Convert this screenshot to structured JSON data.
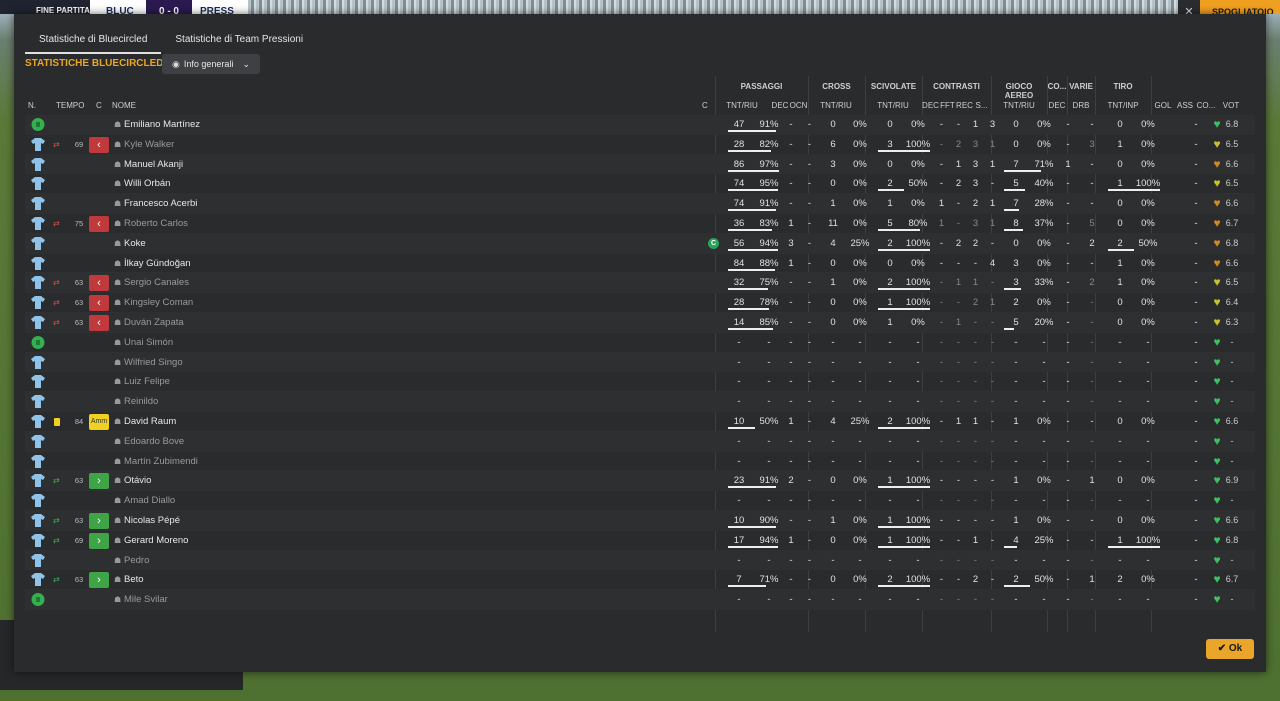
{
  "topbar": {
    "fine": "FINE PARTITA",
    "team_home": "BLUC",
    "score": "0 - 0",
    "team_away": "PRESS",
    "close": "✕",
    "spogliatoio": "SPOGLIATOIO"
  },
  "tabs": [
    {
      "label": "Statistiche di Bluecircled"
    },
    {
      "label": "Statistiche di Team Pressioni"
    }
  ],
  "panel_title": "STATISTICHE BLUECIRCLED",
  "dropdown": {
    "label": "Info generali"
  },
  "groups": {
    "passaggi": "PASSAGGI",
    "cross": "CROSS",
    "scivolate": "SCIVOLATE",
    "contrasti": "CONTRASTI",
    "gioco_aereo": "GIOCO AEREO",
    "co": "CO...",
    "varie": "VARIE",
    "tiro": "TIRO"
  },
  "columns": {
    "n": "N.",
    "tempo": "TEMPO",
    "c": "C",
    "nome": "NOME",
    "cap": "C",
    "pass_tnt": "TNT/RIU",
    "pass_dec": "DEC",
    "pass_ocn": "OCN",
    "cross_tnt": "TNT/RIU",
    "sciv_tnt": "TNT/RIU",
    "con_dec": "DEC",
    "con_fft": "FFT",
    "con_rec": "REC",
    "con_s": "S...",
    "aer_tnt": "TNT/RIU",
    "co_dec": "DEC",
    "drb": "DRB",
    "tiro": "TNT/INP",
    "gol": "GOL",
    "ass": "ASS",
    "cond": "CO...",
    "vot": "VOT"
  },
  "ok_label": "Ok",
  "colors": {
    "accent": "#e9a62a",
    "heart_green": "#3cc060",
    "heart_yellow": "#c8c030",
    "heart_orange": "#d08a20",
    "sub_out": "#c0393b",
    "sub_in": "#3fa446"
  },
  "players": [
    {
      "name": "Emiliano Martínez",
      "kit": "gk",
      "sub": "",
      "minute": "",
      "event": "",
      "pass": [
        "47",
        "91%"
      ],
      "pdec": "-",
      "pocn": "-",
      "cross": [
        "0",
        "0%"
      ],
      "sciv": [
        "0",
        "0%"
      ],
      "con": [
        "-",
        "-",
        "1",
        "3"
      ],
      "aer": [
        "0",
        "0%"
      ],
      "cdec": "-",
      "drb": "-",
      "tiro": [
        "0",
        "0%"
      ],
      "gol": "",
      "ass": "-",
      "cond": "green",
      "vot": "6.8",
      "dim": false,
      "capt": false
    },
    {
      "name": "Kyle Walker",
      "kit": "out",
      "sub": "out",
      "minute": "69",
      "event": "out",
      "pass": [
        "28",
        "82%"
      ],
      "pdec": "-",
      "pocn": "-",
      "cross": [
        "6",
        "0%"
      ],
      "sciv": [
        "3",
        "100%"
      ],
      "con": [
        "-",
        "2",
        "3",
        "1"
      ],
      "aer": [
        "0",
        "0%"
      ],
      "cdec": "-",
      "drb": "3",
      "tiro": [
        "1",
        "0%"
      ],
      "gol": "",
      "ass": "-",
      "cond": "yellow",
      "vot": "6.5",
      "dim": true,
      "capt": false
    },
    {
      "name": "Manuel Akanji",
      "kit": "out",
      "sub": "",
      "minute": "",
      "event": "",
      "pass": [
        "86",
        "97%"
      ],
      "pdec": "-",
      "pocn": "-",
      "cross": [
        "3",
        "0%"
      ],
      "sciv": [
        "0",
        "0%"
      ],
      "con": [
        "-",
        "1",
        "3",
        "1"
      ],
      "aer": [
        "7",
        "71%"
      ],
      "cdec": "1",
      "drb": "-",
      "tiro": [
        "0",
        "0%"
      ],
      "gol": "",
      "ass": "-",
      "cond": "orange",
      "vot": "6.6",
      "dim": false,
      "capt": false
    },
    {
      "name": "Willi Orbán",
      "kit": "out",
      "sub": "",
      "minute": "",
      "event": "",
      "pass": [
        "74",
        "95%"
      ],
      "pdec": "-",
      "pocn": "-",
      "cross": [
        "0",
        "0%"
      ],
      "sciv": [
        "2",
        "50%"
      ],
      "con": [
        "-",
        "2",
        "3",
        "-"
      ],
      "aer": [
        "5",
        "40%"
      ],
      "cdec": "-",
      "drb": "-",
      "tiro": [
        "1",
        "100%"
      ],
      "gol": "",
      "ass": "-",
      "cond": "yellow",
      "vot": "6.5",
      "dim": false,
      "capt": false
    },
    {
      "name": "Francesco Acerbi",
      "kit": "out",
      "sub": "",
      "minute": "",
      "event": "",
      "pass": [
        "74",
        "91%"
      ],
      "pdec": "-",
      "pocn": "-",
      "cross": [
        "1",
        "0%"
      ],
      "sciv": [
        "1",
        "0%"
      ],
      "con": [
        "1",
        "-",
        "2",
        "1"
      ],
      "aer": [
        "7",
        "28%"
      ],
      "cdec": "-",
      "drb": "-",
      "tiro": [
        "0",
        "0%"
      ],
      "gol": "",
      "ass": "-",
      "cond": "orange",
      "vot": "6.6",
      "dim": false,
      "capt": false
    },
    {
      "name": "Roberto Carlos",
      "kit": "out",
      "sub": "out",
      "minute": "75",
      "event": "out",
      "pass": [
        "36",
        "83%"
      ],
      "pdec": "1",
      "pocn": "-",
      "cross": [
        "11",
        "0%"
      ],
      "sciv": [
        "5",
        "80%"
      ],
      "con": [
        "1",
        "-",
        "3",
        "1"
      ],
      "aer": [
        "8",
        "37%"
      ],
      "cdec": "-",
      "drb": "5",
      "tiro": [
        "0",
        "0%"
      ],
      "gol": "",
      "ass": "-",
      "cond": "orange",
      "vot": "6.7",
      "dim": true,
      "capt": false
    },
    {
      "name": "Koke",
      "kit": "out",
      "sub": "",
      "minute": "",
      "event": "",
      "pass": [
        "56",
        "94%"
      ],
      "pdec": "3",
      "pocn": "-",
      "cross": [
        "4",
        "25%"
      ],
      "sciv": [
        "2",
        "100%"
      ],
      "con": [
        "-",
        "2",
        "2",
        "-"
      ],
      "aer": [
        "0",
        "0%"
      ],
      "cdec": "-",
      "drb": "2",
      "tiro": [
        "2",
        "50%"
      ],
      "gol": "",
      "ass": "-",
      "cond": "orange",
      "vot": "6.8",
      "dim": false,
      "capt": true
    },
    {
      "name": "İlkay Gündoğan",
      "kit": "out",
      "sub": "",
      "minute": "",
      "event": "",
      "pass": [
        "84",
        "88%"
      ],
      "pdec": "1",
      "pocn": "-",
      "cross": [
        "0",
        "0%"
      ],
      "sciv": [
        "0",
        "0%"
      ],
      "con": [
        "-",
        "-",
        "-",
        "4"
      ],
      "aer": [
        "3",
        "0%"
      ],
      "cdec": "-",
      "drb": "-",
      "tiro": [
        "1",
        "0%"
      ],
      "gol": "",
      "ass": "-",
      "cond": "orange",
      "vot": "6.6",
      "dim": false,
      "capt": false
    },
    {
      "name": "Sergio Canales",
      "kit": "out",
      "sub": "out",
      "minute": "63",
      "event": "out",
      "pass": [
        "32",
        "75%"
      ],
      "pdec": "-",
      "pocn": "-",
      "cross": [
        "1",
        "0%"
      ],
      "sciv": [
        "2",
        "100%"
      ],
      "con": [
        "-",
        "1",
        "1",
        "-"
      ],
      "aer": [
        "3",
        "33%"
      ],
      "cdec": "-",
      "drb": "2",
      "tiro": [
        "1",
        "0%"
      ],
      "gol": "",
      "ass": "-",
      "cond": "yellow",
      "vot": "6.5",
      "dim": true,
      "capt": false
    },
    {
      "name": "Kingsley Coman",
      "kit": "out",
      "sub": "out",
      "minute": "63",
      "event": "out",
      "pass": [
        "28",
        "78%"
      ],
      "pdec": "-",
      "pocn": "-",
      "cross": [
        "0",
        "0%"
      ],
      "sciv": [
        "1",
        "100%"
      ],
      "con": [
        "-",
        "-",
        "2",
        "1"
      ],
      "aer": [
        "2",
        "0%"
      ],
      "cdec": "-",
      "drb": "-",
      "tiro": [
        "0",
        "0%"
      ],
      "gol": "",
      "ass": "-",
      "cond": "yellow",
      "vot": "6.4",
      "dim": true,
      "capt": false
    },
    {
      "name": "Duván Zapata",
      "kit": "out",
      "sub": "out",
      "minute": "63",
      "event": "out",
      "pass": [
        "14",
        "85%"
      ],
      "pdec": "-",
      "pocn": "-",
      "cross": [
        "0",
        "0%"
      ],
      "sciv": [
        "1",
        "0%"
      ],
      "con": [
        "-",
        "1",
        "-",
        "-"
      ],
      "aer": [
        "5",
        "20%"
      ],
      "cdec": "-",
      "drb": "-",
      "tiro": [
        "0",
        "0%"
      ],
      "gol": "",
      "ass": "-",
      "cond": "yellow",
      "vot": "6.3",
      "dim": true,
      "capt": false
    },
    {
      "name": "Unai Simón",
      "kit": "gk",
      "sub": "",
      "minute": "",
      "event": "",
      "pass": [
        "-",
        "-"
      ],
      "pdec": "-",
      "pocn": "-",
      "cross": [
        "-",
        "-"
      ],
      "sciv": [
        "-",
        "-"
      ],
      "con": [
        "-",
        "-",
        "-",
        "-"
      ],
      "aer": [
        "-",
        "-"
      ],
      "cdec": "-",
      "drb": "-",
      "tiro": [
        "-",
        "-"
      ],
      "gol": "",
      "ass": "-",
      "cond": "green",
      "vot": "-",
      "dim": true,
      "capt": false
    },
    {
      "name": "Wilfried Singo",
      "kit": "out",
      "sub": "",
      "minute": "",
      "event": "",
      "pass": [
        "-",
        "-"
      ],
      "pdec": "-",
      "pocn": "-",
      "cross": [
        "-",
        "-"
      ],
      "sciv": [
        "-",
        "-"
      ],
      "con": [
        "-",
        "-",
        "-",
        "-"
      ],
      "aer": [
        "-",
        "-"
      ],
      "cdec": "-",
      "drb": "-",
      "tiro": [
        "-",
        "-"
      ],
      "gol": "",
      "ass": "-",
      "cond": "green",
      "vot": "-",
      "dim": true,
      "capt": false
    },
    {
      "name": "Luiz Felipe",
      "kit": "out",
      "sub": "",
      "minute": "",
      "event": "",
      "pass": [
        "-",
        "-"
      ],
      "pdec": "-",
      "pocn": "-",
      "cross": [
        "-",
        "-"
      ],
      "sciv": [
        "-",
        "-"
      ],
      "con": [
        "-",
        "-",
        "-",
        "-"
      ],
      "aer": [
        "-",
        "-"
      ],
      "cdec": "-",
      "drb": "-",
      "tiro": [
        "-",
        "-"
      ],
      "gol": "",
      "ass": "-",
      "cond": "green",
      "vot": "-",
      "dim": true,
      "capt": false
    },
    {
      "name": "Reinildo",
      "kit": "out",
      "sub": "",
      "minute": "",
      "event": "",
      "pass": [
        "-",
        "-"
      ],
      "pdec": "-",
      "pocn": "-",
      "cross": [
        "-",
        "-"
      ],
      "sciv": [
        "-",
        "-"
      ],
      "con": [
        "-",
        "-",
        "-",
        "-"
      ],
      "aer": [
        "-",
        "-"
      ],
      "cdec": "-",
      "drb": "-",
      "tiro": [
        "-",
        "-"
      ],
      "gol": "",
      "ass": "-",
      "cond": "green",
      "vot": "-",
      "dim": true,
      "capt": false
    },
    {
      "name": "David Raum",
      "kit": "out",
      "sub": "card",
      "minute": "84",
      "event": "card",
      "event_text": "Amm",
      "pass": [
        "10",
        "50%"
      ],
      "pdec": "1",
      "pocn": "-",
      "cross": [
        "4",
        "25%"
      ],
      "sciv": [
        "2",
        "100%"
      ],
      "con": [
        "-",
        "1",
        "1",
        "-"
      ],
      "aer": [
        "1",
        "0%"
      ],
      "cdec": "-",
      "drb": "-",
      "tiro": [
        "0",
        "0%"
      ],
      "gol": "",
      "ass": "-",
      "cond": "green",
      "vot": "6.6",
      "dim": false,
      "capt": false
    },
    {
      "name": "Edoardo Bove",
      "kit": "out",
      "sub": "",
      "minute": "",
      "event": "",
      "pass": [
        "-",
        "-"
      ],
      "pdec": "-",
      "pocn": "-",
      "cross": [
        "-",
        "-"
      ],
      "sciv": [
        "-",
        "-"
      ],
      "con": [
        "-",
        "-",
        "-",
        "-"
      ],
      "aer": [
        "-",
        "-"
      ],
      "cdec": "-",
      "drb": "-",
      "tiro": [
        "-",
        "-"
      ],
      "gol": "",
      "ass": "-",
      "cond": "green",
      "vot": "-",
      "dim": true,
      "capt": false
    },
    {
      "name": "Martín Zubimendi",
      "kit": "out",
      "sub": "",
      "minute": "",
      "event": "",
      "pass": [
        "-",
        "-"
      ],
      "pdec": "-",
      "pocn": "-",
      "cross": [
        "-",
        "-"
      ],
      "sciv": [
        "-",
        "-"
      ],
      "con": [
        "-",
        "-",
        "-",
        "-"
      ],
      "aer": [
        "-",
        "-"
      ],
      "cdec": "-",
      "drb": "-",
      "tiro": [
        "-",
        "-"
      ],
      "gol": "",
      "ass": "-",
      "cond": "green",
      "vot": "-",
      "dim": true,
      "capt": false
    },
    {
      "name": "Otávio",
      "kit": "out",
      "sub": "in",
      "minute": "63",
      "event": "in",
      "pass": [
        "23",
        "91%"
      ],
      "pdec": "2",
      "pocn": "-",
      "cross": [
        "0",
        "0%"
      ],
      "sciv": [
        "1",
        "100%"
      ],
      "con": [
        "-",
        "-",
        "-",
        "-"
      ],
      "aer": [
        "1",
        "0%"
      ],
      "cdec": "-",
      "drb": "1",
      "tiro": [
        "0",
        "0%"
      ],
      "gol": "",
      "ass": "-",
      "cond": "green",
      "vot": "6.9",
      "dim": false,
      "capt": false
    },
    {
      "name": "Amad Diallo",
      "kit": "out",
      "sub": "",
      "minute": "",
      "event": "",
      "pass": [
        "-",
        "-"
      ],
      "pdec": "-",
      "pocn": "-",
      "cross": [
        "-",
        "-"
      ],
      "sciv": [
        "-",
        "-"
      ],
      "con": [
        "-",
        "-",
        "-",
        "-"
      ],
      "aer": [
        "-",
        "-"
      ],
      "cdec": "-",
      "drb": "-",
      "tiro": [
        "-",
        "-"
      ],
      "gol": "",
      "ass": "-",
      "cond": "green",
      "vot": "-",
      "dim": true,
      "capt": false
    },
    {
      "name": "Nicolas Pépé",
      "kit": "out",
      "sub": "in",
      "minute": "63",
      "event": "in",
      "pass": [
        "10",
        "90%"
      ],
      "pdec": "-",
      "pocn": "-",
      "cross": [
        "1",
        "0%"
      ],
      "sciv": [
        "1",
        "100%"
      ],
      "con": [
        "-",
        "-",
        "-",
        "-"
      ],
      "aer": [
        "1",
        "0%"
      ],
      "cdec": "-",
      "drb": "-",
      "tiro": [
        "0",
        "0%"
      ],
      "gol": "",
      "ass": "-",
      "cond": "green",
      "vot": "6.6",
      "dim": false,
      "capt": false
    },
    {
      "name": "Gerard Moreno",
      "kit": "out",
      "sub": "in",
      "minute": "69",
      "event": "in",
      "pass": [
        "17",
        "94%"
      ],
      "pdec": "1",
      "pocn": "-",
      "cross": [
        "0",
        "0%"
      ],
      "sciv": [
        "1",
        "100%"
      ],
      "con": [
        "-",
        "-",
        "1",
        "-"
      ],
      "aer": [
        "4",
        "25%"
      ],
      "cdec": "-",
      "drb": "-",
      "tiro": [
        "1",
        "100%"
      ],
      "gol": "",
      "ass": "-",
      "cond": "green",
      "vot": "6.8",
      "dim": false,
      "capt": false
    },
    {
      "name": "Pedro",
      "kit": "out",
      "sub": "",
      "minute": "",
      "event": "",
      "pass": [
        "-",
        "-"
      ],
      "pdec": "-",
      "pocn": "-",
      "cross": [
        "-",
        "-"
      ],
      "sciv": [
        "-",
        "-"
      ],
      "con": [
        "-",
        "-",
        "-",
        "-"
      ],
      "aer": [
        "-",
        "-"
      ],
      "cdec": "-",
      "drb": "-",
      "tiro": [
        "-",
        "-"
      ],
      "gol": "",
      "ass": "-",
      "cond": "green",
      "vot": "-",
      "dim": true,
      "capt": false
    },
    {
      "name": "Beto",
      "kit": "out",
      "sub": "in",
      "minute": "63",
      "event": "in",
      "pass": [
        "7",
        "71%"
      ],
      "pdec": "-",
      "pocn": "-",
      "cross": [
        "0",
        "0%"
      ],
      "sciv": [
        "2",
        "100%"
      ],
      "con": [
        "-",
        "-",
        "2",
        "-"
      ],
      "aer": [
        "2",
        "50%"
      ],
      "cdec": "-",
      "drb": "1",
      "tiro": [
        "2",
        "0%"
      ],
      "gol": "",
      "ass": "-",
      "cond": "green",
      "vot": "6.7",
      "dim": false,
      "capt": false
    },
    {
      "name": "Mile Svilar",
      "kit": "gk",
      "sub": "",
      "minute": "",
      "event": "",
      "pass": [
        "-",
        "-"
      ],
      "pdec": "-",
      "pocn": "-",
      "cross": [
        "-",
        "-"
      ],
      "sciv": [
        "-",
        "-"
      ],
      "con": [
        "-",
        "-",
        "-",
        "-"
      ],
      "aer": [
        "-",
        "-"
      ],
      "cdec": "-",
      "drb": "-",
      "tiro": [
        "-",
        "-"
      ],
      "gol": "",
      "ass": "-",
      "cond": "green",
      "vot": "-",
      "dim": true,
      "capt": false
    }
  ]
}
